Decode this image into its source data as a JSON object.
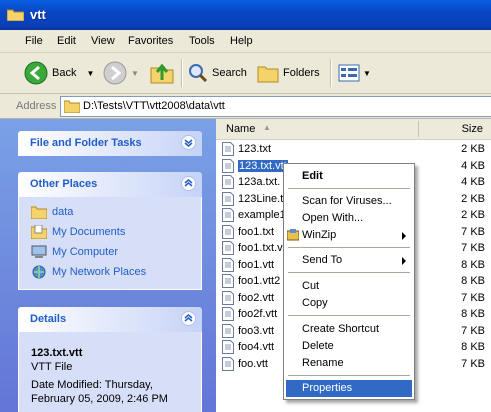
{
  "window": {
    "title": "vtt"
  },
  "menubar": [
    "File",
    "Edit",
    "View",
    "Favorites",
    "Tools",
    "Help"
  ],
  "toolbar": {
    "back": "Back",
    "search": "Search",
    "folders": "Folders"
  },
  "address": {
    "label": "Address",
    "path": "D:\\Tests\\VTT\\vtt2008\\data\\vtt"
  },
  "tasks": {
    "file_folder_tasks": "File and Folder Tasks",
    "other_places": {
      "title": "Other Places",
      "items": [
        "data",
        "My Documents",
        "My Computer",
        "My Network Places"
      ]
    },
    "details": {
      "title": "Details",
      "name": "123.txt.vtt",
      "type": "VTT File",
      "modified": "Date Modified: Thursday, February 05, 2009, 2:46 PM",
      "modified_line1": "Date Modified: Thursday,",
      "modified_line2": "February 05, 2009, 2:46 PM"
    }
  },
  "columns": {
    "name": "Name",
    "size": "Size"
  },
  "files": [
    {
      "name": "123.txt",
      "size": "2 KB"
    },
    {
      "name": "123.txt.vtt",
      "size": "4 KB",
      "selected": true
    },
    {
      "name": "123a.txt.",
      "size": "4 KB"
    },
    {
      "name": "123Line.t",
      "size": "2 KB"
    },
    {
      "name": "example1",
      "size": "2 KB"
    },
    {
      "name": "foo1.txt",
      "size": "7 KB"
    },
    {
      "name": "foo1.txt.v",
      "size": "7 KB"
    },
    {
      "name": "foo1.vtt",
      "size": "8 KB"
    },
    {
      "name": "foo1.vtt2",
      "size": "8 KB"
    },
    {
      "name": "foo2.vtt",
      "size": "7 KB"
    },
    {
      "name": "foo2f.vtt",
      "size": "8 KB"
    },
    {
      "name": "foo3.vtt",
      "size": "7 KB"
    },
    {
      "name": "foo4.vtt",
      "size": "8 KB"
    },
    {
      "name": "foo.vtt",
      "size": "7 KB"
    }
  ],
  "context_menu": {
    "edit": "Edit",
    "scan": "Scan for Viruses...",
    "open_with": "Open With...",
    "winzip": "WinZip",
    "send_to": "Send To",
    "cut": "Cut",
    "copy": "Copy",
    "create_shortcut": "Create Shortcut",
    "delete": "Delete",
    "rename": "Rename",
    "properties": "Properties"
  }
}
